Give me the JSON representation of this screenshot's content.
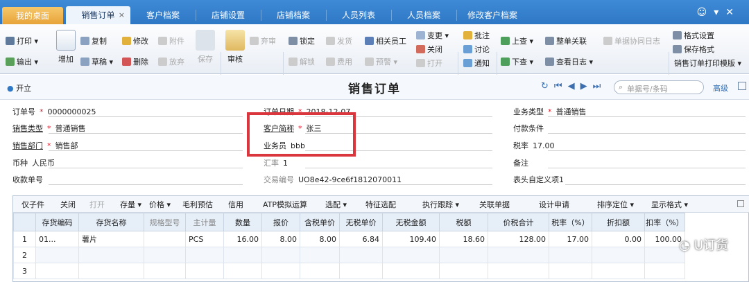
{
  "tabs": {
    "home": "我的桌面",
    "active": "销售订单",
    "t3": "客户档案",
    "t4": "店铺设置",
    "t5": "店铺档案",
    "t6": "人员列表",
    "t7": "人员档案",
    "t8": "修改客户档案",
    "close": "×"
  },
  "ribbon": {
    "print": "打印",
    "export": "输出",
    "add": "增加",
    "copy": "复制",
    "draft": "草稿",
    "edit": "修改",
    "delete": "删除",
    "attach": "附件",
    "abandon": "放弃",
    "save": "保存",
    "audit": "审核",
    "discard": "弃审",
    "lock": "锁定",
    "unlock": "解锁",
    "ship": "发货",
    "cost": "费用",
    "staff": "相关员工",
    "prepay": "预警",
    "change": "变更",
    "close": "关闭",
    "open": "打开",
    "annotate": "批注",
    "discuss": "讨论",
    "notify": "通知",
    "up": "上查",
    "down": "下查",
    "link": "整单关联",
    "log": "查看日志",
    "collab": "单据协同日志",
    "fmt": "格式设置",
    "savefmt": "保存格式",
    "tpl": "销售订单打印模版"
  },
  "toolbar": {
    "open": "开立",
    "title": "销售订单",
    "search_placeholder": "单据号/条码",
    "advanced": "高级"
  },
  "form": {
    "order_no_label": "订单号",
    "order_no": "0000000025",
    "order_date_label": "订单日期",
    "order_date": "2018-12-07",
    "biz_type_label": "业务类型",
    "biz_type": "普通销售",
    "sale_type_label": "销售类型",
    "sale_type": "普通销售",
    "customer_label": "客户简称",
    "customer": "张三",
    "pay_terms_label": "付款条件",
    "dept_label": "销售部门",
    "dept": "销售部",
    "salesman_label": "业务员",
    "salesman": "bbb",
    "tax_rate_label": "税率",
    "tax_rate": "17.00",
    "currency_label": "币种",
    "currency": "人民币",
    "exrate_label": "汇率",
    "exrate": "1",
    "remark_label": "备注",
    "receipt_label": "收款单号",
    "txn_label": "交易编号",
    "txn": "UO8e42-9ce6f1812070011",
    "custom_label": "表头自定义项1"
  },
  "grid_toolbar": [
    "仅子件",
    "关闭",
    "打开",
    "存量 ▾",
    "价格 ▾",
    "毛利预估",
    "信用",
    "ATP模拟运算",
    "选配 ▾",
    "特征选配",
    "执行跟踪 ▾",
    "关联单据",
    "设计申请",
    "排序定位 ▾",
    "显示格式 ▾"
  ],
  "columns": [
    "",
    "存货编码",
    "存货名称",
    "规格型号",
    "主计量",
    "数量",
    "报价",
    "含税单价",
    "无税单价",
    "无税金额",
    "税额",
    "价税合计",
    "税率（%）",
    "折扣额",
    "扣率（%）"
  ],
  "rows": [
    [
      "1",
      "01...",
      "薯片",
      "",
      "PCS",
      "16.00",
      "8.00",
      "8.00",
      "6.84",
      "109.40",
      "18.60",
      "128.00",
      "17.00",
      "0.00",
      "100.00"
    ],
    [
      "2",
      "",
      "",
      "",
      "",
      "",
      "",
      "",
      "",
      "",
      "",
      "",
      "",
      "",
      ""
    ],
    [
      "3",
      "",
      "",
      "",
      "",
      "",
      "",
      "",
      "",
      "",
      "",
      "",
      "",
      "",
      ""
    ]
  ],
  "watermark": "U订货"
}
